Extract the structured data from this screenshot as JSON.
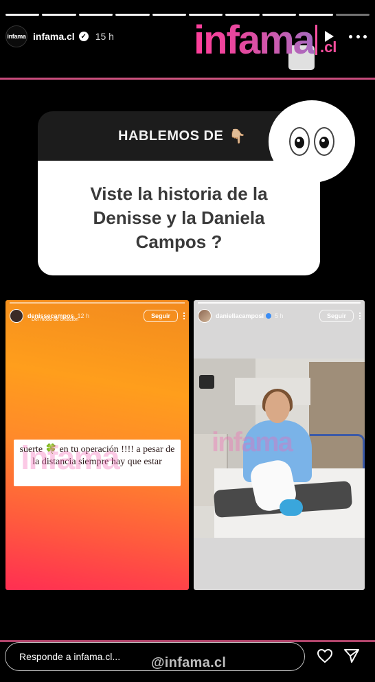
{
  "progress": {
    "segments": 10,
    "completed": 9
  },
  "header": {
    "avatar_text": "infama",
    "username": "infama.cl",
    "verified_mark": "✓",
    "time": "15 h",
    "logo_word": "infama",
    "logo_suffix": ".cl",
    "icons": [
      "play-icon",
      "more-icon"
    ]
  },
  "question": {
    "title": "HABLEMOS DE",
    "pointing_emoji": "👇🏼",
    "text": "Viste la historia  de la Denisse y la Daniela Campos ?",
    "eyes_emoji_name": "eyes-icon"
  },
  "stories": [
    {
      "username": "denissecampos",
      "time": "12 h",
      "subtitle": "Del modo de creación",
      "follow_label": "Seguir",
      "sticker_text": "suerte 🍀 en tu  operación  !!!! a pesar de la distancia siempre hay que estar",
      "watermark": "infama"
    },
    {
      "username": "daniellacamposl",
      "time": "5 h",
      "follow_label": "Seguir",
      "watermark": "infama"
    }
  ],
  "footer": {
    "reply_placeholder": "Responde a infama.cl...",
    "handle": "@infama.cl",
    "icons": [
      "heart-icon",
      "send-icon"
    ]
  },
  "colors": {
    "accent_pink": "#ff4fa0",
    "divider_pink": "#c94b7d",
    "story_orange": "#ff9e1c",
    "story_red": "#ff2e52"
  }
}
